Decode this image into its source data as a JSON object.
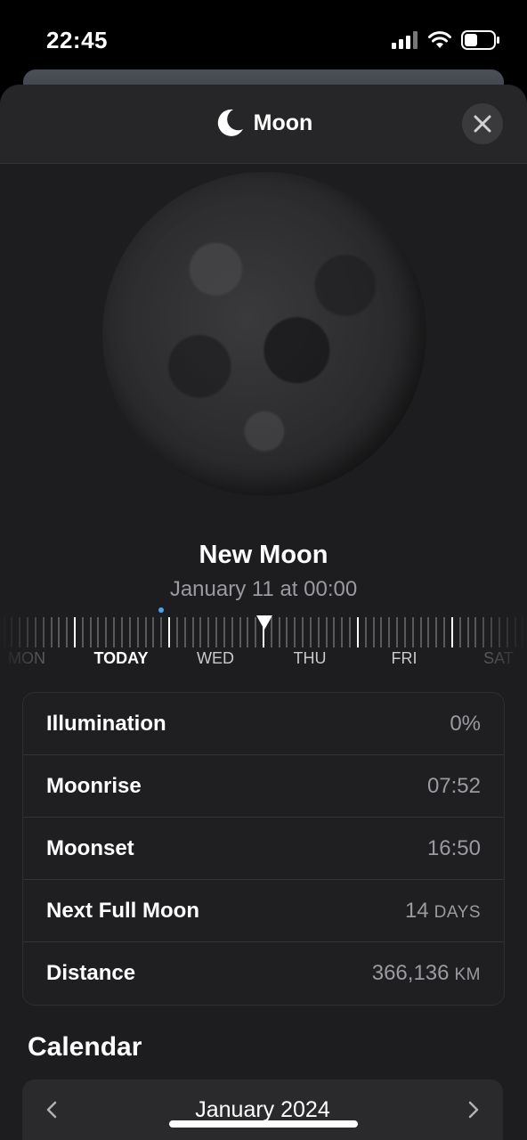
{
  "status": {
    "time": "22:45"
  },
  "header": {
    "title": "Moon",
    "icon": "crescent-moon-icon",
    "close_icon": "close-icon"
  },
  "phase": {
    "name": "New Moon",
    "date": "January 11 at 00:00"
  },
  "timeline": {
    "days": [
      {
        "label": "MON",
        "today": false
      },
      {
        "label": "TODAY",
        "today": true
      },
      {
        "label": "WED",
        "today": false
      },
      {
        "label": "THU",
        "today": false
      },
      {
        "label": "FRI",
        "today": false
      },
      {
        "label": "SAT",
        "today": false
      }
    ]
  },
  "details": [
    {
      "label": "Illumination",
      "value": "0%",
      "unit": ""
    },
    {
      "label": "Moonrise",
      "value": "07:52",
      "unit": ""
    },
    {
      "label": "Moonset",
      "value": "16:50",
      "unit": ""
    },
    {
      "label": "Next Full Moon",
      "value": "14",
      "unit": "DAYS"
    },
    {
      "label": "Distance",
      "value": "366,136",
      "unit": "KM"
    }
  ],
  "calendar": {
    "title": "Calendar",
    "month": "January 2024"
  },
  "colors": {
    "sheet_bg": "#1d1d1f",
    "accent_dot": "#4aa3f0",
    "secondary_text": "#9a9aa0"
  }
}
